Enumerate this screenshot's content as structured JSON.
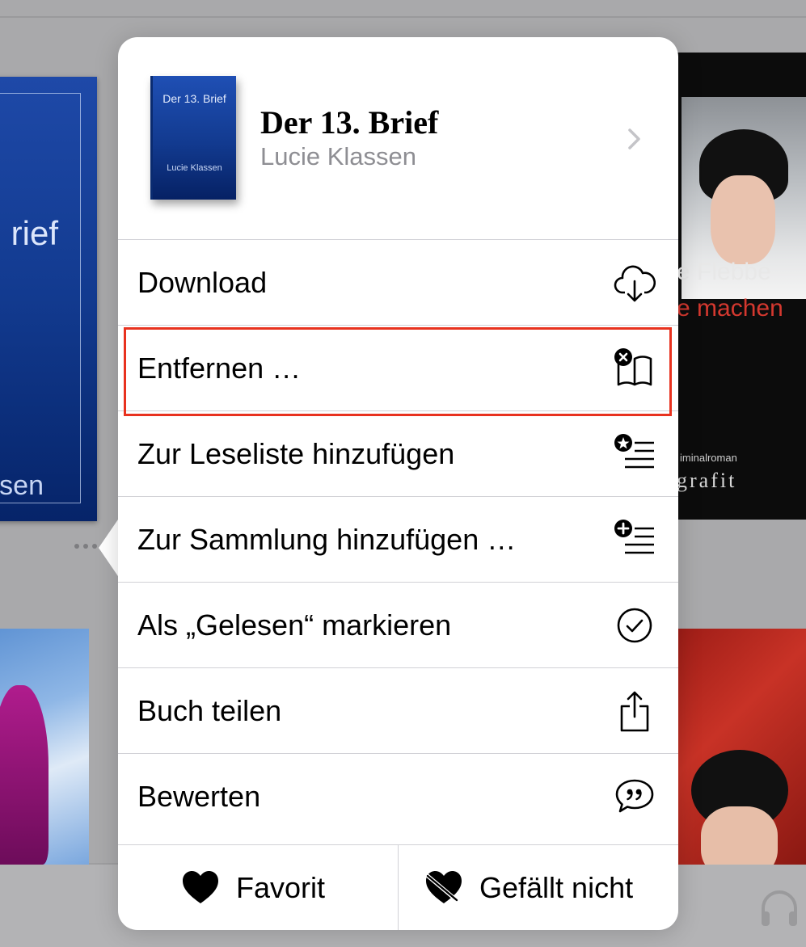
{
  "background": {
    "left_cover": {
      "title_fragment": "rief",
      "author_fragment": "sen"
    },
    "right_cover": {
      "author_fragment": "e Flebbe",
      "subtitle_fragment": "e machen",
      "genre_fragment": "iminalroman",
      "publisher_fragment": "grafit"
    }
  },
  "popover": {
    "book": {
      "cover_title": "Der 13. Brief",
      "cover_author": "Lucie Klassen",
      "title": "Der 13. Brief",
      "author": "Lucie Klassen"
    },
    "items": [
      {
        "label": "Download",
        "icon": "cloud-download-icon"
      },
      {
        "label": "Entfernen …",
        "icon": "remove-book-icon"
      },
      {
        "label": "Zur Leseliste hinzufügen",
        "icon": "want-to-read-icon"
      },
      {
        "label": "Zur Sammlung hinzufügen …",
        "icon": "add-to-collection-icon"
      },
      {
        "label": "Als „Gelesen“ markieren",
        "icon": "checkmark-circle-icon"
      },
      {
        "label": "Buch teilen",
        "icon": "share-icon"
      },
      {
        "label": "Bewerten",
        "icon": "speech-bubble-icon"
      }
    ],
    "favorite_label": "Favorit",
    "dislike_label": "Gefällt nicht"
  },
  "colors": {
    "highlight": "#e8321f",
    "separator": "#d1d1d6",
    "secondary_text": "#8e8e93"
  }
}
